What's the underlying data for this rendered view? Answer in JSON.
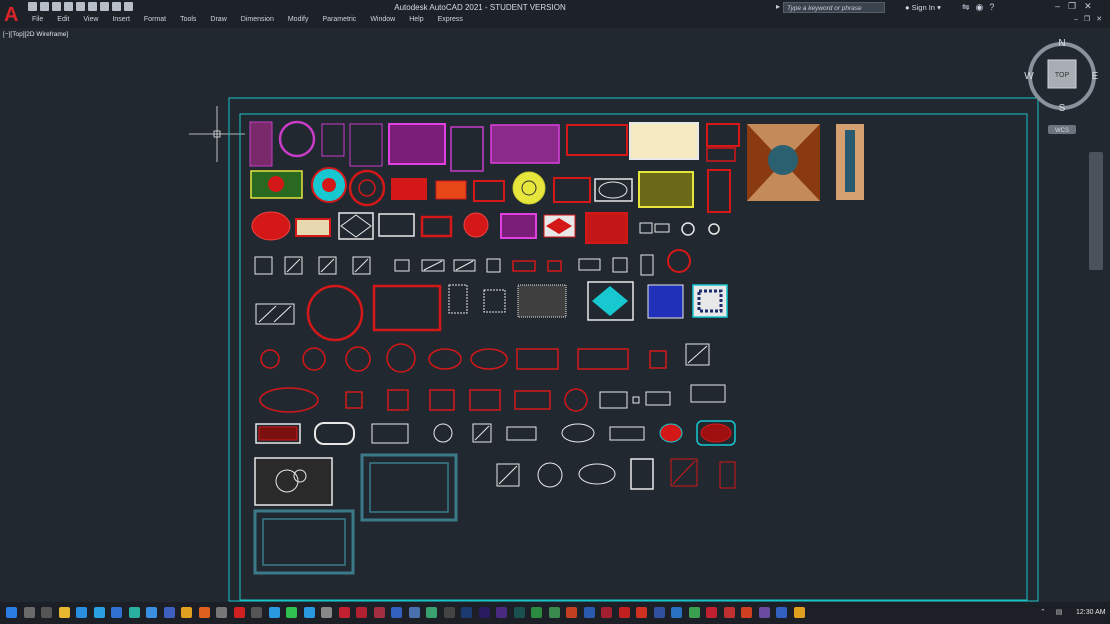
{
  "window": {
    "title": "Autodesk AutoCAD 2021 - STUDENT VERSION",
    "search_placeholder": "Type a keyword or phrase",
    "sign_in": "Sign In"
  },
  "menu": [
    "File",
    "Edit",
    "View",
    "Insert",
    "Format",
    "Tools",
    "Draw",
    "Dimension",
    "Modify",
    "Parametric",
    "Window",
    "Help",
    "Express"
  ],
  "viewport": {
    "label": "[−][Top][2D Wireframe]"
  },
  "viewcube": {
    "n": "N",
    "s": "S",
    "e": "E",
    "w": "W",
    "face": "TOP",
    "wcs": "WCS"
  },
  "taskbar": {
    "time": "12:30 AM"
  },
  "colors": {
    "background": "#212830",
    "border": "#19c4c8",
    "red": "#d41818",
    "magenta": "#c83cc8",
    "white": "#e8e8e8",
    "cyan": "#18c8d0",
    "yellow": "#e6e63c",
    "slate": "#3c7a8a"
  }
}
